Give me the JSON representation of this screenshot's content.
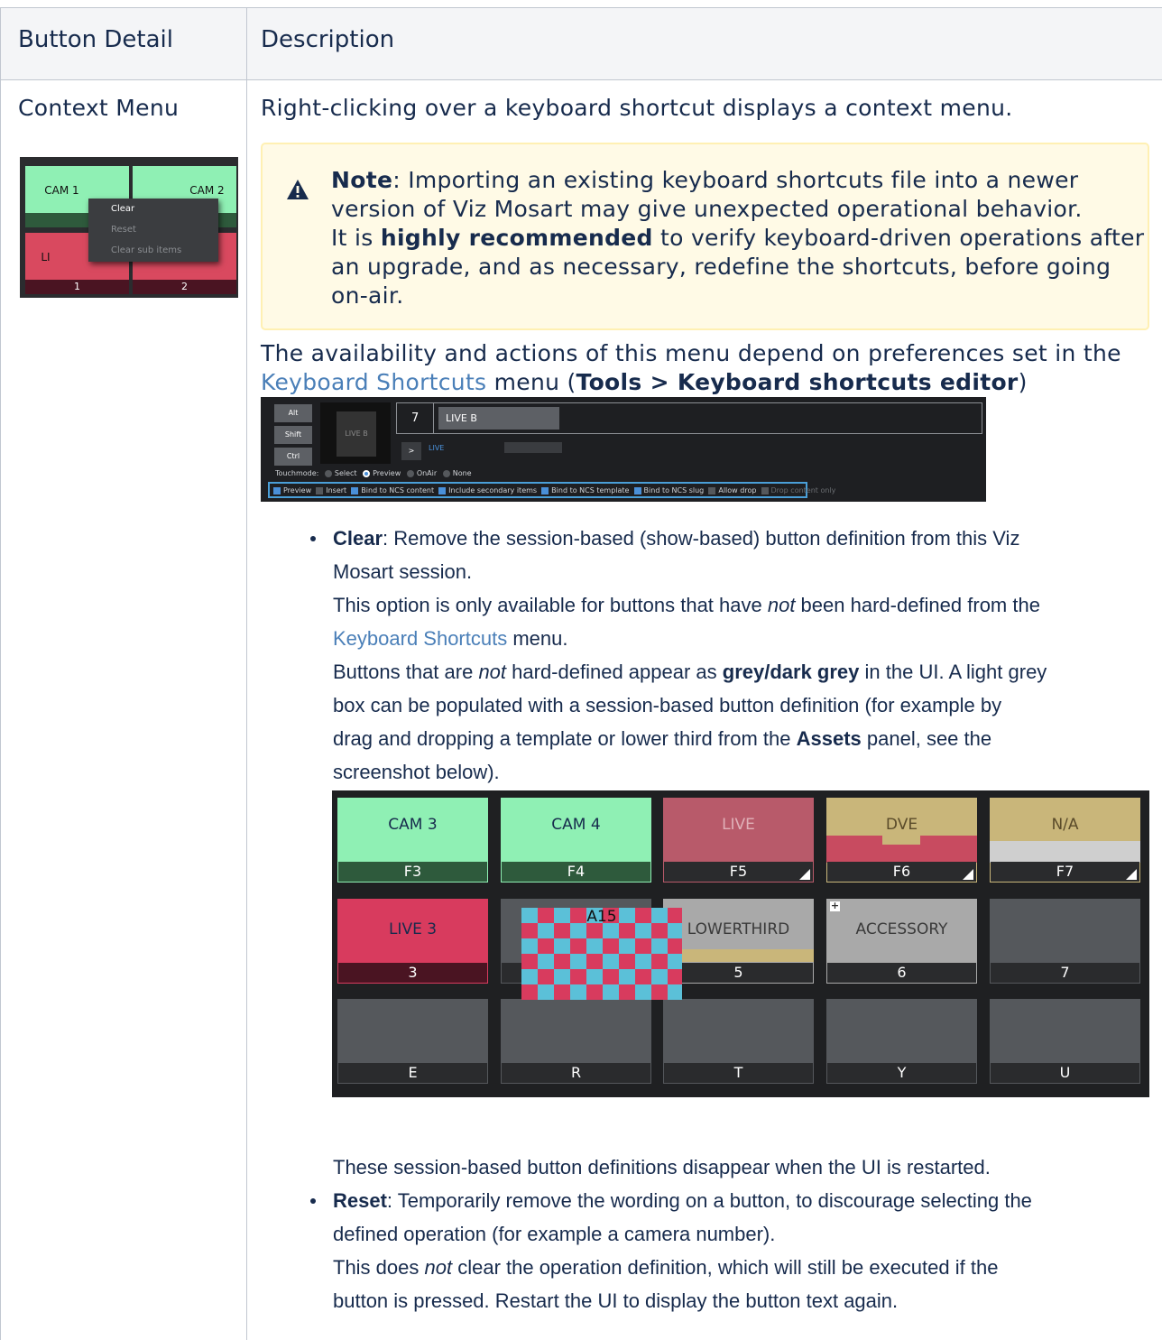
{
  "table": {
    "header": {
      "col1": "Button Detail",
      "col2": "Description"
    },
    "row_label": "Context Menu",
    "intro": "Right-clicking over a keyboard shortcut displays a context menu."
  },
  "context_menu_thumb": {
    "buttons": [
      {
        "name": "CAM 1",
        "label": "",
        "color": "#8ff0b4"
      },
      {
        "name": "CAM 2",
        "label": "",
        "color": "#8ff0b4"
      },
      {
        "name": "LI",
        "label": "1",
        "color": "#d9495f"
      },
      {
        "name": "",
        "label": "2",
        "color": "#d9495f"
      }
    ],
    "menu": [
      "Clear",
      "Reset",
      "Clear sub items"
    ]
  },
  "note": {
    "icon": "warning-icon",
    "lead": "Note",
    "line1": ": Importing an existing keyboard shortcuts file into a newer",
    "line2": "version of Viz Mosart may give unexpected operational behavior.",
    "line3a": "It is ",
    "line3b": "highly recommended",
    "line3c": " to verify keyboard-driven operations after",
    "line4": "an upgrade, and as necessary, redefine the shortcuts, before going",
    "line5": "on-air."
  },
  "availability": {
    "line1": "The availability and actions of this menu depend on preferences set in the",
    "link": "Keyboard Shortcuts",
    "mid": " menu (",
    "bold": "Tools > Keyboard shortcuts editor",
    "end": ")"
  },
  "editor": {
    "modifiers": [
      "Alt",
      "Shift",
      "Ctrl"
    ],
    "preview_label": "LIVE B",
    "key_number": "7",
    "key_name": "LIVE B",
    "arrow": ">",
    "live": "LIVE",
    "touchmode_label": "Touchmode:",
    "touchmodes": [
      "Select",
      "Preview",
      "OnAir",
      "None"
    ],
    "options": [
      "Preview",
      "Insert",
      "Bind to NCS content",
      "Include secondary items",
      "Bind to NCS template",
      "Bind to NCS slug",
      "Allow drop",
      "Drop content only"
    ]
  },
  "clear_item": {
    "title": "Clear",
    "l1": ": Remove the session-based (show-based) button definition from this Viz",
    "l2": "Mosart session.",
    "l3a": "This option is only available for buttons that have ",
    "l3b": "not",
    "l3c": " been hard-defined from the",
    "l4_link": "Keyboard Shortcuts",
    "l4_rest": " menu.",
    "l5a": "Buttons that are ",
    "l5b": "not",
    "l5c": " hard-defined appear as ",
    "l5d": "grey/dark grey",
    "l5e": " in the UI. A light grey",
    "l6": "box can be populated with a session-based button definition (for example by",
    "l7a": "drag and dropping a template or lower third from the ",
    "l7b": "Assets",
    "l7c": " panel, see the",
    "l8": "screenshot below).",
    "after": "These session-based button definitions disappear when the UI is restarted."
  },
  "grid": {
    "row1": [
      {
        "name": "CAM 3",
        "label": "F3"
      },
      {
        "name": "CAM 4",
        "label": "F4"
      },
      {
        "name": "LIVE",
        "label": "F5"
      },
      {
        "name": "DVE",
        "label": "F6"
      },
      {
        "name": "N/A",
        "label": "F7"
      }
    ],
    "row2": [
      {
        "name": "LIVE 3",
        "label": "3"
      },
      {
        "name": "",
        "label": ""
      },
      {
        "name": "LOWERTHIRD",
        "label": "5"
      },
      {
        "name": "ACCESSORY",
        "label": "6"
      },
      {
        "name": "",
        "label": "7"
      }
    ],
    "row3": [
      {
        "name": "",
        "label": "E"
      },
      {
        "name": "",
        "label": "R"
      },
      {
        "name": "",
        "label": "T"
      },
      {
        "name": "",
        "label": "Y"
      },
      {
        "name": "",
        "label": "U"
      }
    ],
    "drag_item": "A15",
    "accessory_icon": "+"
  },
  "reset_item": {
    "title": "Reset",
    "l1": ": Temporarily remove the wording on a button, to discourage selecting the",
    "l2": "defined operation (for example a camera number).",
    "l3a": "This does ",
    "l3b": "not",
    "l3c": " clear the operation definition, which will still be executed if the",
    "l4": "button is pressed. Restart the UI to display the button text again."
  }
}
